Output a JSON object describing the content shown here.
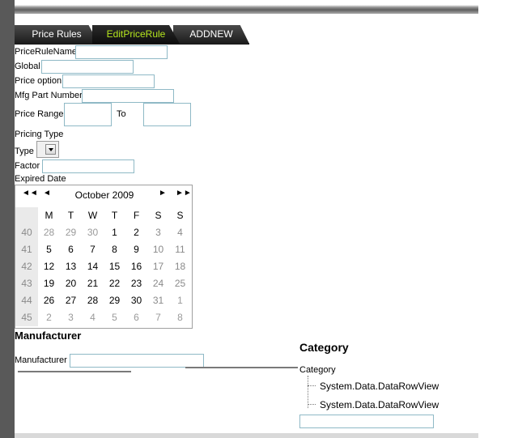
{
  "tabs": [
    {
      "label": "Price Rules",
      "active": false
    },
    {
      "label": "EditPriceRule",
      "active": true
    },
    {
      "label": "ADDNEW",
      "active": false
    }
  ],
  "form": {
    "price_rule_name_label": "PriceRuleName",
    "global_label": "Global",
    "price_option_label": "Price option",
    "mfg_part_label": "Mfg Part Number",
    "price_range_label": "Price Range",
    "to_label": "To",
    "pricing_type_label": "Pricing Type",
    "type_label": "Type",
    "factor_label": "Factor",
    "expired_date_label": "Expired Date"
  },
  "calendar": {
    "title": "October 2009",
    "nav": {
      "prev_year": "◄◄",
      "prev_month": "◄",
      "next_month": "►",
      "next_year": "►►"
    },
    "weekdays": [
      "M",
      "T",
      "W",
      "T",
      "F",
      "S",
      "S"
    ],
    "weeks": [
      {
        "num": "40",
        "days": [
          "28",
          "29",
          "30",
          "1",
          "2",
          "3",
          "4"
        ],
        "other": [
          true,
          true,
          true,
          false,
          false,
          false,
          false
        ]
      },
      {
        "num": "41",
        "days": [
          "5",
          "6",
          "7",
          "8",
          "9",
          "10",
          "11"
        ],
        "other": [
          false,
          false,
          false,
          false,
          false,
          false,
          false
        ]
      },
      {
        "num": "42",
        "days": [
          "12",
          "13",
          "14",
          "15",
          "16",
          "17",
          "18"
        ],
        "other": [
          false,
          false,
          false,
          false,
          false,
          false,
          false
        ]
      },
      {
        "num": "43",
        "days": [
          "19",
          "20",
          "21",
          "22",
          "23",
          "24",
          "25"
        ],
        "other": [
          false,
          false,
          false,
          false,
          false,
          false,
          false
        ]
      },
      {
        "num": "44",
        "days": [
          "26",
          "27",
          "28",
          "29",
          "30",
          "31",
          "1"
        ],
        "other": [
          false,
          false,
          false,
          false,
          false,
          false,
          true
        ]
      },
      {
        "num": "45",
        "days": [
          "2",
          "3",
          "4",
          "5",
          "6",
          "7",
          "8"
        ],
        "other": [
          true,
          true,
          true,
          true,
          true,
          true,
          true
        ]
      }
    ]
  },
  "manufacturer": {
    "heading": "Manufacturer",
    "field_label": "Manufacturer"
  },
  "category": {
    "heading": "Category",
    "tree_root": "Category",
    "tree_items": [
      "System.Data.DataRowView",
      "System.Data.DataRowView"
    ]
  },
  "colors": {
    "active_tab_text": "#b5e61d",
    "input_border": "#8fb9c6",
    "sidebar": "#595959"
  }
}
